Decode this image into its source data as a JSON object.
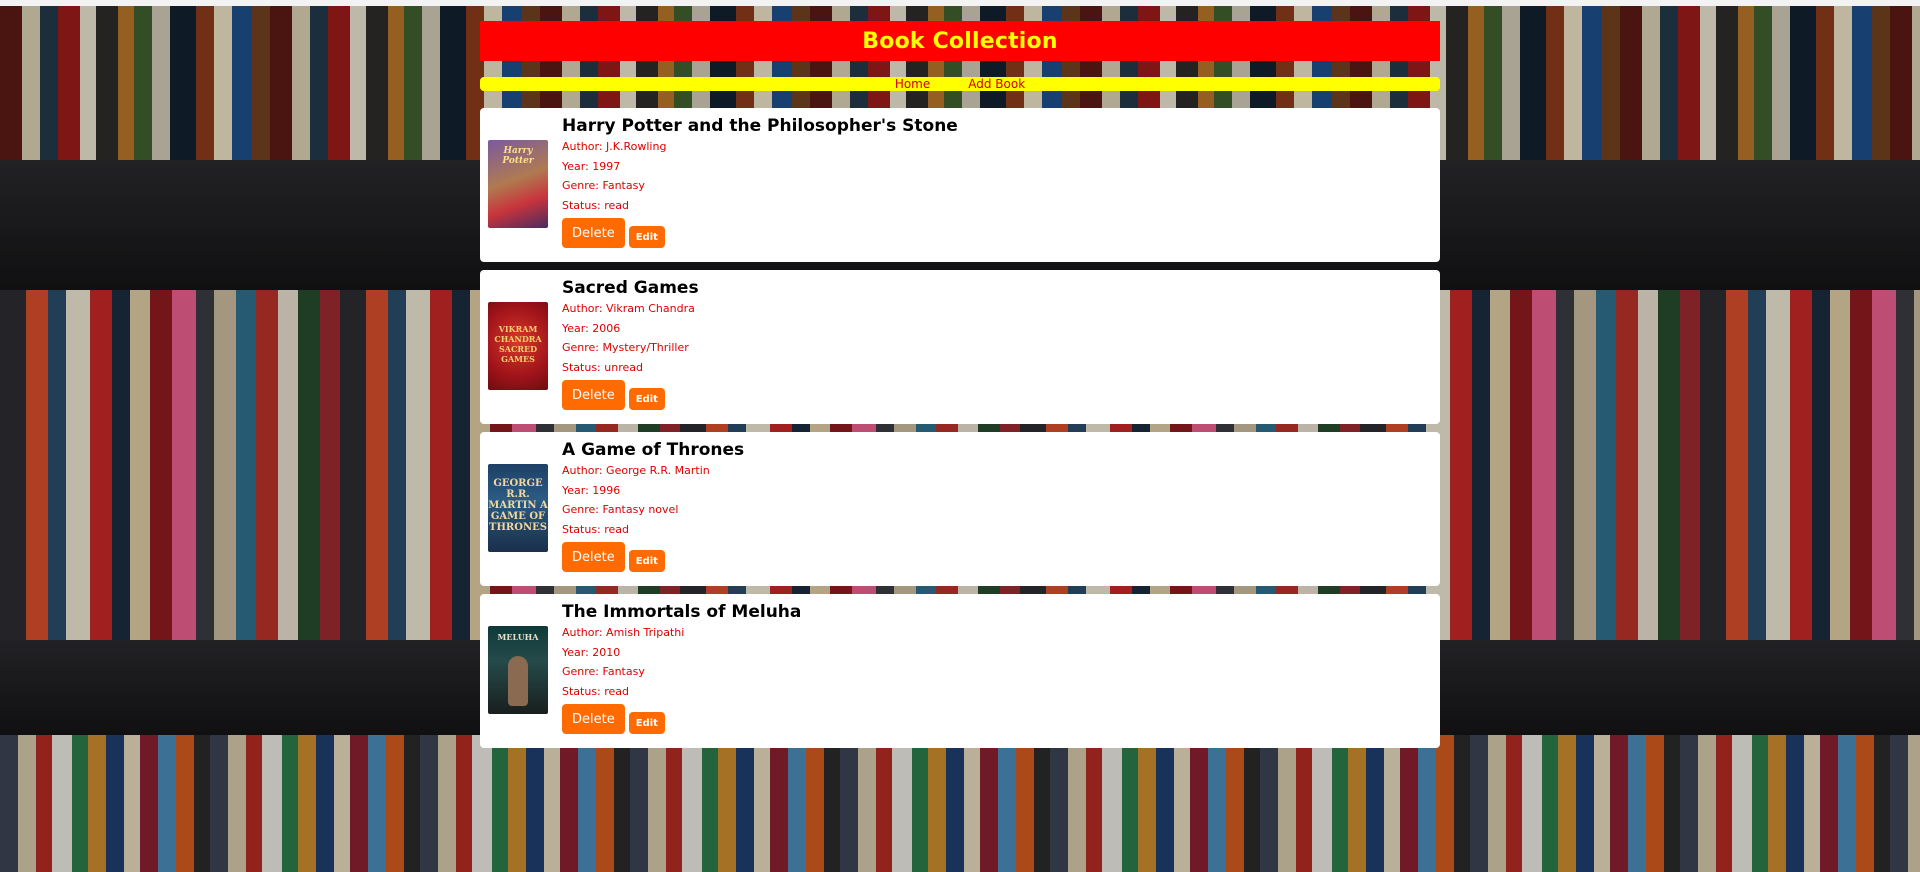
{
  "app": {
    "title": "Book Collection"
  },
  "nav": {
    "home": "Home",
    "add_book": "Add Book"
  },
  "labels": {
    "delete": "Delete",
    "edit": "Edit"
  },
  "colors": {
    "header_bg": "#ff0000",
    "header_text": "#ffff00",
    "nav_bg": "#ffff00",
    "nav_text": "#d40000",
    "meta_text": "#e00000",
    "button_bg": "#ff6b00"
  },
  "books": [
    {
      "title": "Harry Potter and the Philosopher's Stone",
      "author": "Author: J.K.Rowling",
      "year": "Year: 1997",
      "genre": "Genre: Fantasy",
      "status": "Status: read",
      "cover_text": "Harry Potter"
    },
    {
      "title": "Sacred Games",
      "author": "Author: Vikram Chandra",
      "year": "Year: 2006",
      "genre": "Genre: Mystery/Thriller",
      "status": "Status: unread",
      "cover_text": "VIKRAM CHANDRA SACRED GAMES"
    },
    {
      "title": "A Game of Thrones",
      "author": "Author: George R.R. Martin",
      "year": "Year: 1996",
      "genre": "Genre: Fantasy novel",
      "status": "Status: read",
      "cover_text": "GEORGE R.R. MARTIN A GAME OF THRONES"
    },
    {
      "title": "The Immortals of Meluha",
      "author": "Author: Amish Tripathi",
      "year": "Year: 2010",
      "genre": "Genre: Fantasy",
      "status": "Status: read",
      "cover_text": "MELUHA"
    }
  ]
}
